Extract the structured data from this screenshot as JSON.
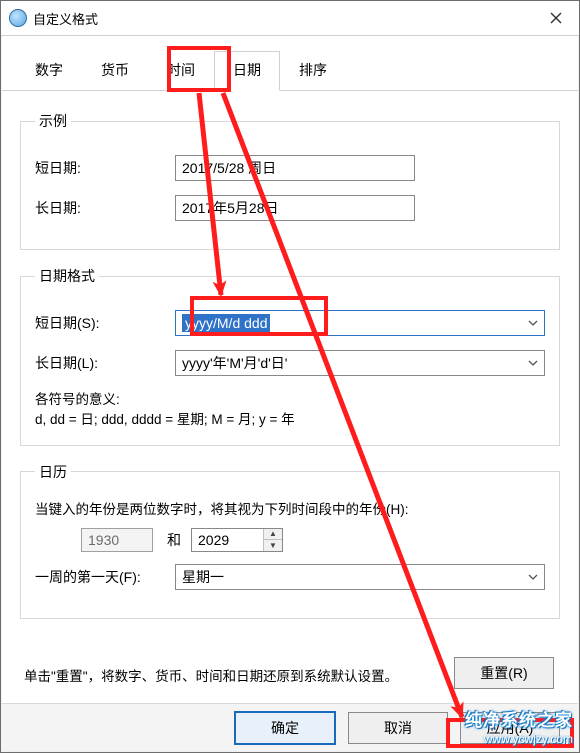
{
  "title": "自定义格式",
  "tabs": [
    "数字",
    "货币",
    "时间",
    "日期",
    "排序"
  ],
  "active_tab_index": 3,
  "example": {
    "legend": "示例",
    "short_label": "短日期:",
    "short_value": "2017/5/28 周日",
    "long_label": "长日期:",
    "long_value": "2017年5月28日"
  },
  "format": {
    "legend": "日期格式",
    "short_label": "短日期(S):",
    "short_value": "yyyy/M/d ddd",
    "long_label": "长日期(L):",
    "long_value": "yyyy'年'M'月'd'日'",
    "meaning_label": "各符号的意义:",
    "meaning_text": "d, dd = 日;  ddd, dddd = 星期;  M = 月;  y = 年"
  },
  "calendar": {
    "legend": "日历",
    "two_digit": "当键入的年份是两位数字时，将其视为下列时间段中的年份(H):",
    "year_from": "1930",
    "and": "和",
    "year_to": "2029",
    "first_day_label": "一周的第一天(F):",
    "first_day_value": "星期一"
  },
  "footer": {
    "note": "单击\"重置\"，将数字、货币、时间和日期还原到系统默认设置。",
    "reset": "重置(R)",
    "ok": "确定",
    "cancel": "取消",
    "apply": "应用(A)"
  },
  "watermark": {
    "line1": "纯净系统之家",
    "line2": "www.ycwjzy.com"
  }
}
